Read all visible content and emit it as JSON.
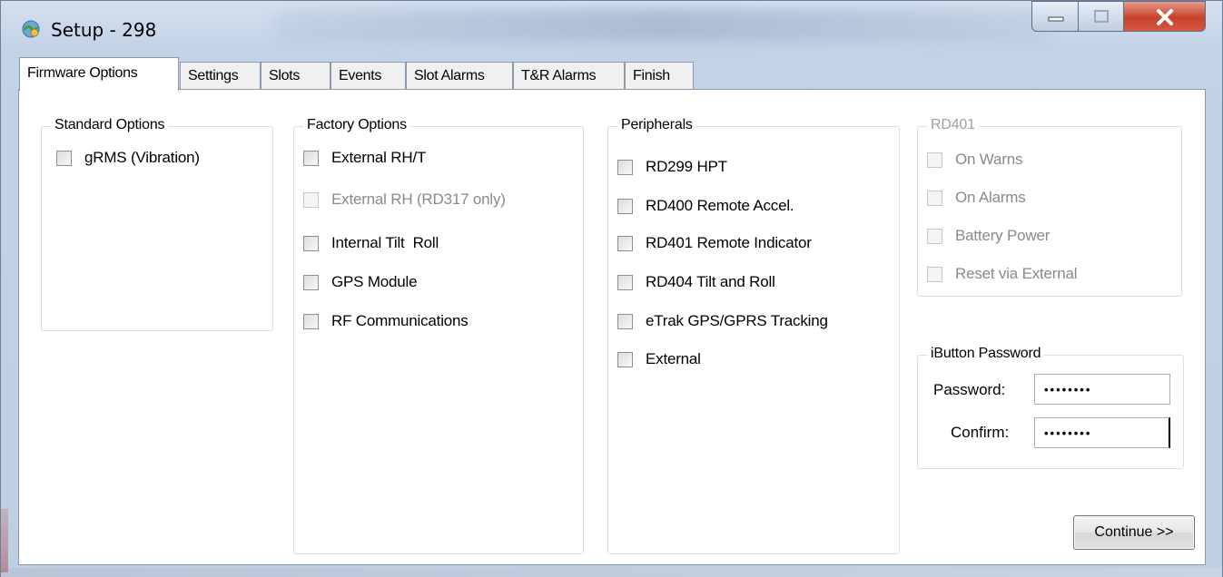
{
  "window": {
    "title": "Setup - 298"
  },
  "tabs": [
    "Firmware Options",
    "Settings",
    "Slots",
    "Events",
    "Slot Alarms",
    "T&R Alarms",
    "Finish"
  ],
  "standard_options": {
    "title": "Standard Options",
    "items": [
      {
        "label": "gRMS (Vibration)",
        "checked": false,
        "enabled": true
      }
    ]
  },
  "factory_options": {
    "title": "Factory Options",
    "items": [
      {
        "label": "External RH/T",
        "checked": false,
        "enabled": true
      },
      {
        "label": "External RH (RD317 only)",
        "checked": false,
        "enabled": false
      },
      {
        "label": "Internal Tilt  Roll",
        "checked": false,
        "enabled": true
      },
      {
        "label": "GPS Module",
        "checked": false,
        "enabled": true
      },
      {
        "label": "RF Communications",
        "checked": false,
        "enabled": true
      }
    ]
  },
  "peripherals": {
    "title": "Peripherals",
    "items": [
      {
        "label": "RD299 HPT",
        "checked": false,
        "enabled": true
      },
      {
        "label": "RD400 Remote Accel.",
        "checked": false,
        "enabled": true
      },
      {
        "label": "RD401 Remote Indicator",
        "checked": false,
        "enabled": true
      },
      {
        "label": "RD404 Tilt and Roll",
        "checked": false,
        "enabled": true
      },
      {
        "label": "eTrak GPS/GPRS Tracking",
        "checked": false,
        "enabled": true
      },
      {
        "label": "External",
        "checked": false,
        "enabled": true
      }
    ]
  },
  "rd401": {
    "title": "RD401",
    "items": [
      {
        "label": "On Warns",
        "checked": false,
        "enabled": false
      },
      {
        "label": "On Alarms",
        "checked": false,
        "enabled": false
      },
      {
        "label": "Battery Power",
        "checked": false,
        "enabled": false
      },
      {
        "label": "Reset via External",
        "checked": false,
        "enabled": false
      }
    ]
  },
  "ibutton": {
    "title": "iButton Password",
    "password_label": "Password:",
    "password_value": "••••••••",
    "confirm_label": "Confirm:",
    "confirm_value": "••••••••"
  },
  "continue_label": "Continue >>"
}
